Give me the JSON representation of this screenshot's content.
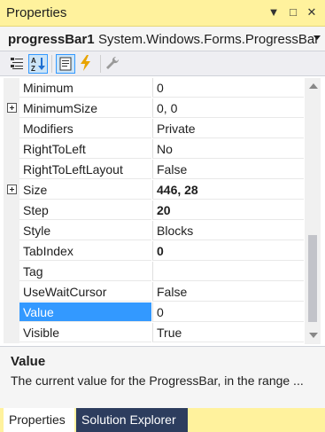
{
  "window": {
    "title": "Properties",
    "controls": {
      "menu_arrow": "▼",
      "maximize": "□",
      "close": "✕"
    }
  },
  "object_selector": {
    "name": "progressBar1",
    "type": "System.Windows.Forms.ProgressBar"
  },
  "toolbar": {
    "buttons": [
      {
        "icon": "categorized-icon",
        "active": false
      },
      {
        "icon": "alphabetical-icon",
        "active": true
      },
      {
        "icon": "properties-icon",
        "active": true
      },
      {
        "icon": "events-icon",
        "active": false
      },
      {
        "icon": "property-pages-icon",
        "active": false
      }
    ]
  },
  "properties": [
    {
      "name": "Minimum",
      "value": "0",
      "expandable": false,
      "bold": false
    },
    {
      "name": "MinimumSize",
      "value": "0, 0",
      "expandable": true,
      "bold": false
    },
    {
      "name": "Modifiers",
      "value": "Private",
      "expandable": false,
      "bold": false
    },
    {
      "name": "RightToLeft",
      "value": "No",
      "expandable": false,
      "bold": false
    },
    {
      "name": "RightToLeftLayout",
      "value": "False",
      "expandable": false,
      "bold": false
    },
    {
      "name": "Size",
      "value": "446, 28",
      "expandable": true,
      "bold": true
    },
    {
      "name": "Step",
      "value": "20",
      "expandable": false,
      "bold": true
    },
    {
      "name": "Style",
      "value": "Blocks",
      "expandable": false,
      "bold": false
    },
    {
      "name": "TabIndex",
      "value": "0",
      "expandable": false,
      "bold": true
    },
    {
      "name": "Tag",
      "value": "",
      "expandable": false,
      "bold": false
    },
    {
      "name": "UseWaitCursor",
      "value": "False",
      "expandable": false,
      "bold": false
    },
    {
      "name": "Value",
      "value": "0",
      "expandable": false,
      "bold": false,
      "selected": true
    },
    {
      "name": "Visible",
      "value": "True",
      "expandable": false,
      "bold": false
    }
  ],
  "description": {
    "title": "Value",
    "text": "The current value for the ProgressBar, in the range ..."
  },
  "tabs": [
    {
      "label": "Properties",
      "active": true
    },
    {
      "label": "Solution Explorer",
      "active": false
    }
  ],
  "colors": {
    "title_bar": "#fff29d",
    "selection": "#3399ff",
    "inactive_tab": "#2d3d5e"
  }
}
